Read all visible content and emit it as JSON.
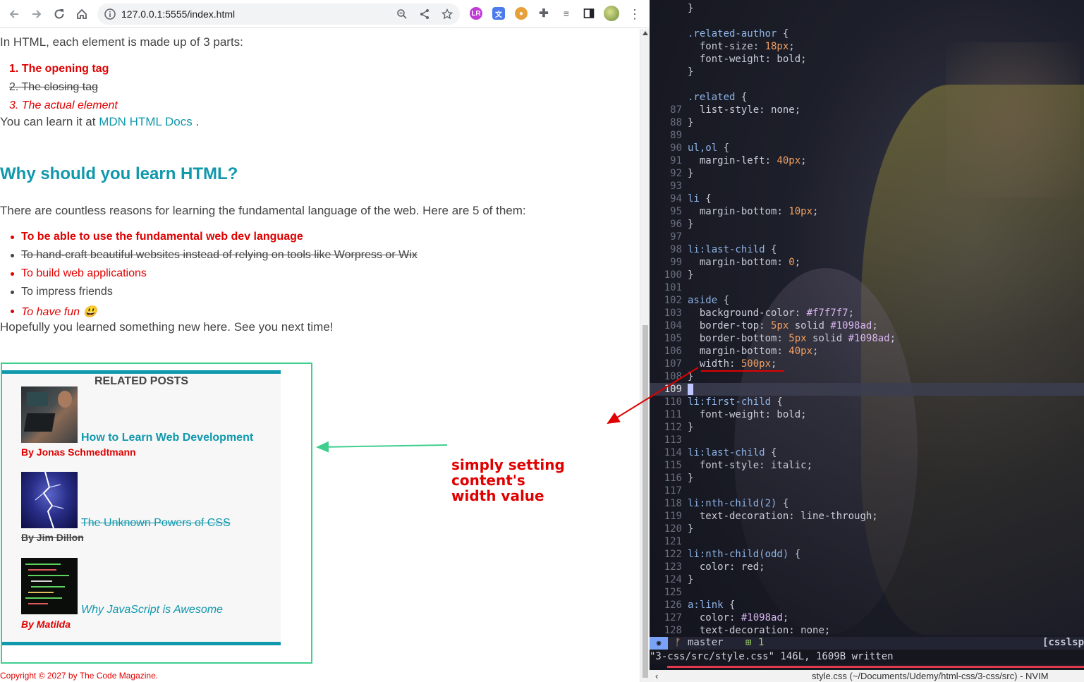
{
  "browser": {
    "url": "127.0.0.1:5555/index.html",
    "extensions": [
      "translate-icon",
      "cookie-icon",
      "puzzle-icon",
      "playlist-icon",
      "sidepanel-icon",
      "profile-avatar"
    ]
  },
  "page": {
    "intro": "In HTML, each element is made up of 3 parts:",
    "ol_items": [
      "1. The opening tag",
      "2. The closing tag",
      "3. The actual element"
    ],
    "learn_prefix": "You can learn it at",
    "learn_link": "MDN HTML Docs",
    "learn_suffix": ".",
    "heading": "Why should you learn HTML?",
    "reasons_intro": "There are countless reasons for learning the fundamental language of the web. Here are 5 of them:",
    "ul_items": [
      "To be able to use the fundamental web dev language",
      "To hand-craft beautiful websites instead of relying on tools like Worpress or Wix",
      "To build web applications",
      "To impress friends",
      "To have fun 😃"
    ],
    "outro": "Hopefully you learned something new here. See you next time!",
    "aside": {
      "title": "RELATED POSTS",
      "posts": [
        {
          "title": "How to Learn Web Development",
          "author": "By Jonas Schmedtmann"
        },
        {
          "title": "The Unknown Powers of CSS",
          "author": "By Jim Dillon"
        },
        {
          "title": "Why JavaScript is Awesome",
          "author": "By Matilda"
        }
      ]
    },
    "copyright": "Copyright © 2027 by The Code Magazine."
  },
  "annotation": {
    "line1": "simply setting content's",
    "line2": "width value",
    "arrow_color": "#e00000",
    "box_color": "#3ecf8e"
  },
  "editor": {
    "lines": [
      {
        "n": "",
        "t": "}"
      },
      {
        "n": "",
        "t": ""
      },
      {
        "n": "",
        "t": ".related-author {"
      },
      {
        "n": "",
        "t": "  font-size: 18px;"
      },
      {
        "n": "",
        "t": "  font-weight: bold;"
      },
      {
        "n": "",
        "t": "}"
      },
      {
        "n": "",
        "t": ""
      },
      {
        "n": "",
        "t": ".related {"
      },
      {
        "n": "87",
        "t": "  list-style: none;"
      },
      {
        "n": "88",
        "t": "}"
      },
      {
        "n": "89",
        "t": ""
      },
      {
        "n": "90",
        "t": "ul,ol {"
      },
      {
        "n": "91",
        "t": "  margin-left: 40px;"
      },
      {
        "n": "92",
        "t": "}"
      },
      {
        "n": "93",
        "t": ""
      },
      {
        "n": "94",
        "t": "li {"
      },
      {
        "n": "95",
        "t": "  margin-bottom: 10px;"
      },
      {
        "n": "96",
        "t": "}"
      },
      {
        "n": "97",
        "t": ""
      },
      {
        "n": "98",
        "t": "li:last-child {"
      },
      {
        "n": "99",
        "t": "  margin-bottom: 0;"
      },
      {
        "n": "100",
        "t": "}"
      },
      {
        "n": "101",
        "t": ""
      },
      {
        "n": "102",
        "t": "aside {"
      },
      {
        "n": "103",
        "t": "  background-color: #f7f7f7;"
      },
      {
        "n": "104",
        "t": "  border-top: 5px solid #1098ad;"
      },
      {
        "n": "105",
        "t": "  border-bottom: 5px solid #1098ad;"
      },
      {
        "n": "106",
        "t": "  margin-bottom: 40px;"
      },
      {
        "n": "107",
        "t": "  width: 500px;"
      },
      {
        "n": "108",
        "t": "}"
      },
      {
        "n": "109",
        "t": ""
      },
      {
        "n": "110",
        "t": "li:first-child {"
      },
      {
        "n": "111",
        "t": "  font-weight: bold;"
      },
      {
        "n": "112",
        "t": "}"
      },
      {
        "n": "113",
        "t": ""
      },
      {
        "n": "114",
        "t": "li:last-child {"
      },
      {
        "n": "115",
        "t": "  font-style: italic;"
      },
      {
        "n": "116",
        "t": "}"
      },
      {
        "n": "117",
        "t": ""
      },
      {
        "n": "118",
        "t": "li:nth-child(2) {"
      },
      {
        "n": "119",
        "t": "  text-decoration: line-through;"
      },
      {
        "n": "120",
        "t": "}"
      },
      {
        "n": "121",
        "t": ""
      },
      {
        "n": "122",
        "t": "li:nth-child(odd) {"
      },
      {
        "n": "123",
        "t": "  color: red;"
      },
      {
        "n": "124",
        "t": "}"
      },
      {
        "n": "125",
        "t": ""
      },
      {
        "n": "126",
        "t": "a:link {"
      },
      {
        "n": "127",
        "t": "  color: #1098ad;"
      },
      {
        "n": "128",
        "t": "  text-decoration: none;"
      }
    ],
    "status_branch": "master",
    "status_count": "1",
    "status_filetype": "[csslsp",
    "cmdline": "\"3-css/src/style.css\" 146L, 1609B written",
    "window_title": "style.css (~/Documents/Udemy/html-css/3-css/src) - NVIM"
  }
}
